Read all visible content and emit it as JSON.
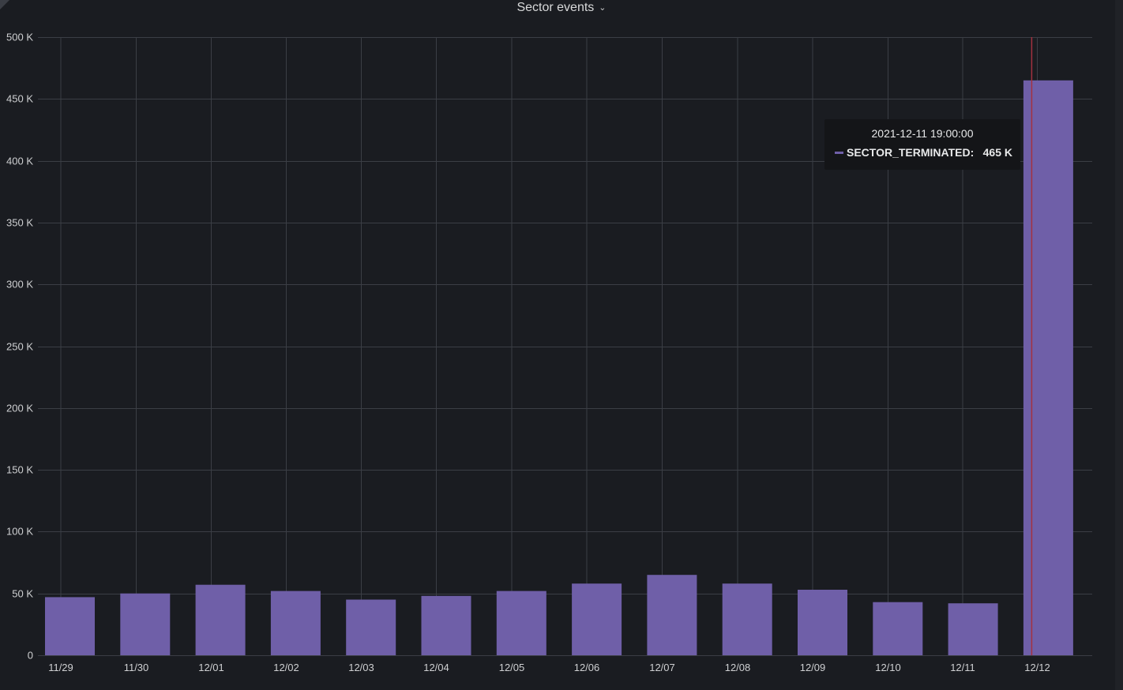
{
  "panel": {
    "title": "Sector events",
    "menu_icon": "chevron-down-icon"
  },
  "tooltip": {
    "time": "2021-12-11 19:00:00",
    "series": "SECTOR_TERMINATED:",
    "value": "465 K"
  },
  "colors": {
    "background": "#1a1c21",
    "bar": "#6f5fa8",
    "grid": "#3b3e45",
    "crosshair": "#a4313f",
    "text": "#d8d9da"
  },
  "chart_data": {
    "type": "bar",
    "title": "Sector events",
    "categories": [
      "11/29",
      "11/30",
      "12/01",
      "12/02",
      "12/03",
      "12/04",
      "12/05",
      "12/06",
      "12/07",
      "12/08",
      "12/09",
      "12/10",
      "12/11",
      "12/12"
    ],
    "series": [
      {
        "name": "SECTOR_TERMINATED",
        "values": [
          47000,
          50000,
          57000,
          52000,
          45000,
          48000,
          52000,
          58000,
          65000,
          58000,
          53000,
          43000,
          42000,
          465000
        ]
      }
    ],
    "ylim": [
      0,
      500000
    ],
    "y_ticks": [
      0,
      50000,
      100000,
      150000,
      200000,
      250000,
      300000,
      350000,
      400000,
      450000,
      500000
    ],
    "y_tick_labels": [
      "0",
      "50 K",
      "100 K",
      "150 K",
      "200 K",
      "250 K",
      "300 K",
      "350 K",
      "400 K",
      "450 K",
      "500 K"
    ],
    "grid": true,
    "legend": "none",
    "hover_category": "12/12"
  }
}
